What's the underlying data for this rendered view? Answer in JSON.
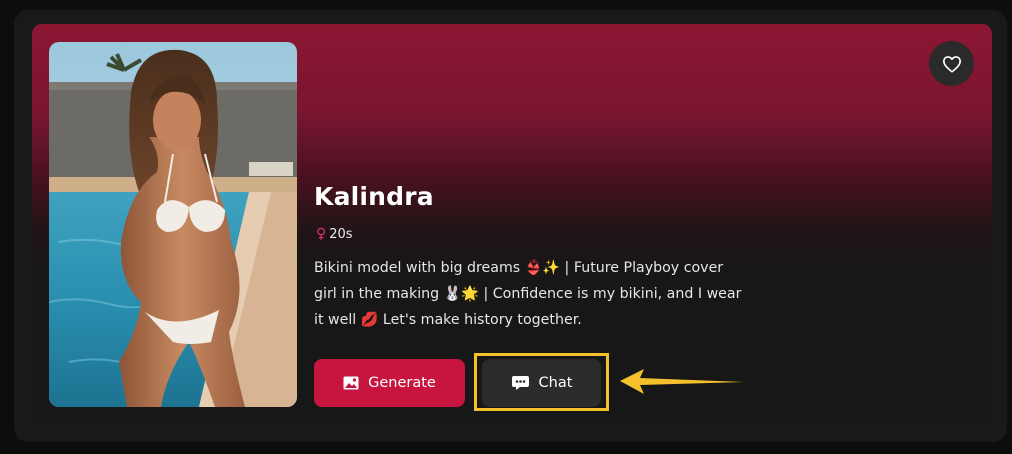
{
  "profile": {
    "name": "Kalindra",
    "age": "20s",
    "gender_icon": "female-icon",
    "bio_line1": "Bikini model with big dreams 👙✨ | Future Playboy cover",
    "bio_line2": "girl in the making 🐰🌟 | Confidence is my bikini, and I wear",
    "bio_line3": "it well 💋 Let's make history together.",
    "photo_icon": "profile-photo"
  },
  "actions": {
    "generate_label": "Generate",
    "generate_icon": "image-icon",
    "chat_label": "Chat",
    "chat_icon": "chat-bubble-icon",
    "favorite_icon": "heart-icon"
  },
  "annotation": {
    "highlight_color": "#f4c02c",
    "arrow_icon": "arrow-left-icon"
  },
  "colors": {
    "accent": "#c8153f",
    "banner": "#8b1632",
    "gender": "#e0356a"
  }
}
